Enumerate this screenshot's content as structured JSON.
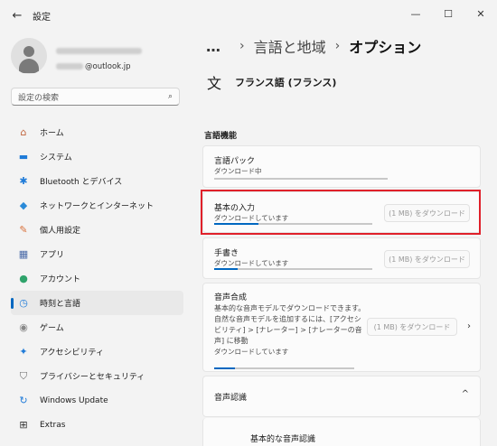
{
  "window": {
    "title": "設定",
    "back_icon": "←",
    "minimize": "—",
    "maximize": "☐",
    "close": "✕"
  },
  "profile": {
    "email": "@outlook.jp"
  },
  "search": {
    "placeholder": "設定の検索",
    "icon": "⌕"
  },
  "nav": [
    {
      "label": "ホーム",
      "icon": "⌂",
      "color": "#c0623a"
    },
    {
      "label": "システム",
      "icon": "▬",
      "color": "#1f7bd8"
    },
    {
      "label": "Bluetooth とデバイス",
      "icon": "✱",
      "color": "#1f7bd8"
    },
    {
      "label": "ネットワークとインターネット",
      "icon": "◆",
      "color": "#2a8ad8"
    },
    {
      "label": "個人用設定",
      "icon": "✎",
      "color": "#d9703a"
    },
    {
      "label": "アプリ",
      "icon": "▦",
      "color": "#4a6aa8"
    },
    {
      "label": "アカウント",
      "icon": "●",
      "color": "#2fa36b"
    },
    {
      "label": "時刻と言語",
      "icon": "◷",
      "color": "#1f7bd8"
    },
    {
      "label": "ゲーム",
      "icon": "◉",
      "color": "#888888"
    },
    {
      "label": "アクセシビリティ",
      "icon": "✦",
      "color": "#1f7bd8"
    },
    {
      "label": "プライバシーとセキュリティ",
      "icon": "⛉",
      "color": "#6a6a6a"
    },
    {
      "label": "Windows Update",
      "icon": "↻",
      "color": "#1f7bd8"
    },
    {
      "label": "Extras",
      "icon": "⊞",
      "color": "#333333"
    }
  ],
  "breadcrumb": {
    "dots": "…",
    "sep": "›",
    "parent": "言語と地域",
    "current": "オプション"
  },
  "language": {
    "icon": "文",
    "name": "フランス語 (フランス)"
  },
  "section": {
    "title": "言語機能"
  },
  "features": {
    "pack": {
      "title": "言語パック",
      "status": "ダウンロード中",
      "progress": 0
    },
    "basic": {
      "title": "基本の入力",
      "status": "ダウンロードしています",
      "button": "(1 MB) をダウンロード",
      "progress": 0.28
    },
    "handwriting": {
      "title": "手書き",
      "status": "ダウンロードしています",
      "button": "(1 MB) をダウンロード",
      "progress": 0.15
    },
    "tts": {
      "title": "音声合成",
      "description": "基本的な音声モデルでダウンロードできます。自然な音声モデルを追加するには、[アクセシビリティ] > [ナレーター] > [ナレーターの音声] に移動",
      "status": "ダウンロードしています",
      "button": "(1 MB) をダウンロード",
      "chevron": "›",
      "progress": 0.15
    },
    "speech": {
      "title": "音声認識",
      "chevron": "^",
      "sub_label": "基本的な音声認識"
    }
  },
  "colors": {
    "accent": "#0067c0",
    "highlight": "#e0202a"
  }
}
